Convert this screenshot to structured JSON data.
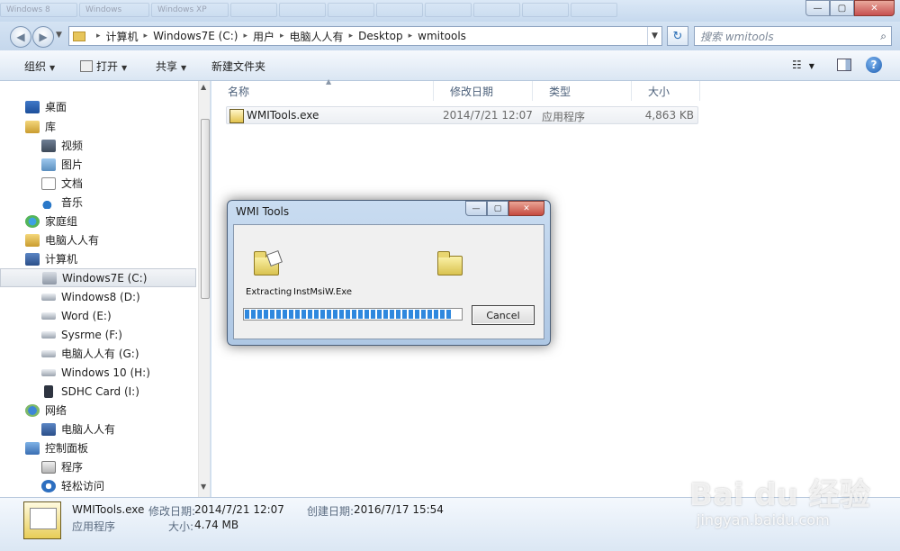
{
  "window": {
    "background_tabs": [
      "Windows 8",
      "Windows",
      "Windows XP",
      "",
      "",
      "",
      "",
      "",
      "",
      "",
      "",
      ""
    ],
    "controls": {
      "minimize": "—",
      "maximize": "▢",
      "close": "✕"
    }
  },
  "address": {
    "crumbs": [
      "计算机",
      "Windows7E (C:)",
      "用户",
      "电脑人人有",
      "Desktop",
      "wmitools"
    ],
    "search_placeholder": "搜索 wmitools"
  },
  "toolbar": {
    "organize": "组织",
    "open": "打开",
    "share": "共享",
    "new_folder": "新建文件夹"
  },
  "nav": {
    "items": [
      {
        "label": "桌面",
        "icon": "desktop-icon",
        "indent": 0
      },
      {
        "label": "库",
        "icon": "library-icon",
        "indent": 0
      },
      {
        "label": "视频",
        "icon": "video-icon",
        "indent": 1
      },
      {
        "label": "图片",
        "icon": "pictures-icon",
        "indent": 1
      },
      {
        "label": "文档",
        "icon": "documents-icon",
        "indent": 1
      },
      {
        "label": "音乐",
        "icon": "music-icon",
        "indent": 1
      },
      {
        "label": "家庭组",
        "icon": "homegroup-icon",
        "indent": 0
      },
      {
        "label": "电脑人人有",
        "icon": "user-folder-icon",
        "indent": 0
      },
      {
        "label": "计算机",
        "icon": "computer-icon",
        "indent": 0
      },
      {
        "label": "Windows7E (C:)",
        "icon": "system-drive-icon",
        "indent": 1,
        "selected": true
      },
      {
        "label": "Windows8 (D:)",
        "icon": "drive-icon",
        "indent": 1
      },
      {
        "label": "Word (E:)",
        "icon": "drive-icon",
        "indent": 1
      },
      {
        "label": "Sysrme (F:)",
        "icon": "drive-icon",
        "indent": 1
      },
      {
        "label": "电脑人人有 (G:)",
        "icon": "drive-icon",
        "indent": 1
      },
      {
        "label": "Windows 10 (H:)",
        "icon": "drive-icon",
        "indent": 1
      },
      {
        "label": "SDHC Card (I:)",
        "icon": "sd-card-icon",
        "indent": 1
      },
      {
        "label": "网络",
        "icon": "network-icon",
        "indent": 0
      },
      {
        "label": "电脑人人有",
        "icon": "network-computer-icon",
        "indent": 1
      },
      {
        "label": "控制面板",
        "icon": "control-panel-icon",
        "indent": 0
      },
      {
        "label": "程序",
        "icon": "programs-icon",
        "indent": 1
      },
      {
        "label": "轻松访问",
        "icon": "ease-of-access-icon",
        "indent": 1
      }
    ]
  },
  "list": {
    "headers": {
      "name": "名称",
      "modified": "修改日期",
      "type": "类型",
      "size": "大小"
    },
    "files": [
      {
        "name": "WMITools.exe",
        "modified": "2014/7/21 12:07",
        "type": "应用程序",
        "size": "4,863 KB"
      }
    ]
  },
  "details": {
    "name": "WMITools.exe",
    "type": "应用程序",
    "modified_label": "修改日期:",
    "modified": "2014/7/21 12:07",
    "size_label": "大小:",
    "size": "4.74 MB",
    "created_label": "创建日期:",
    "created": "2016/7/17 15:54"
  },
  "dialog": {
    "title": "WMI Tools",
    "status_verb": "Extracting",
    "status_file": "InstMsiW.Exe",
    "progress": 0.96,
    "cancel": "Cancel"
  },
  "watermark": {
    "brand": "Bai  du 经验",
    "url": "jingyan.baidu.com"
  },
  "colors": {
    "progress": "#2f88de",
    "selection": "#e1e6ec",
    "chrome": "#cfe0f2"
  }
}
